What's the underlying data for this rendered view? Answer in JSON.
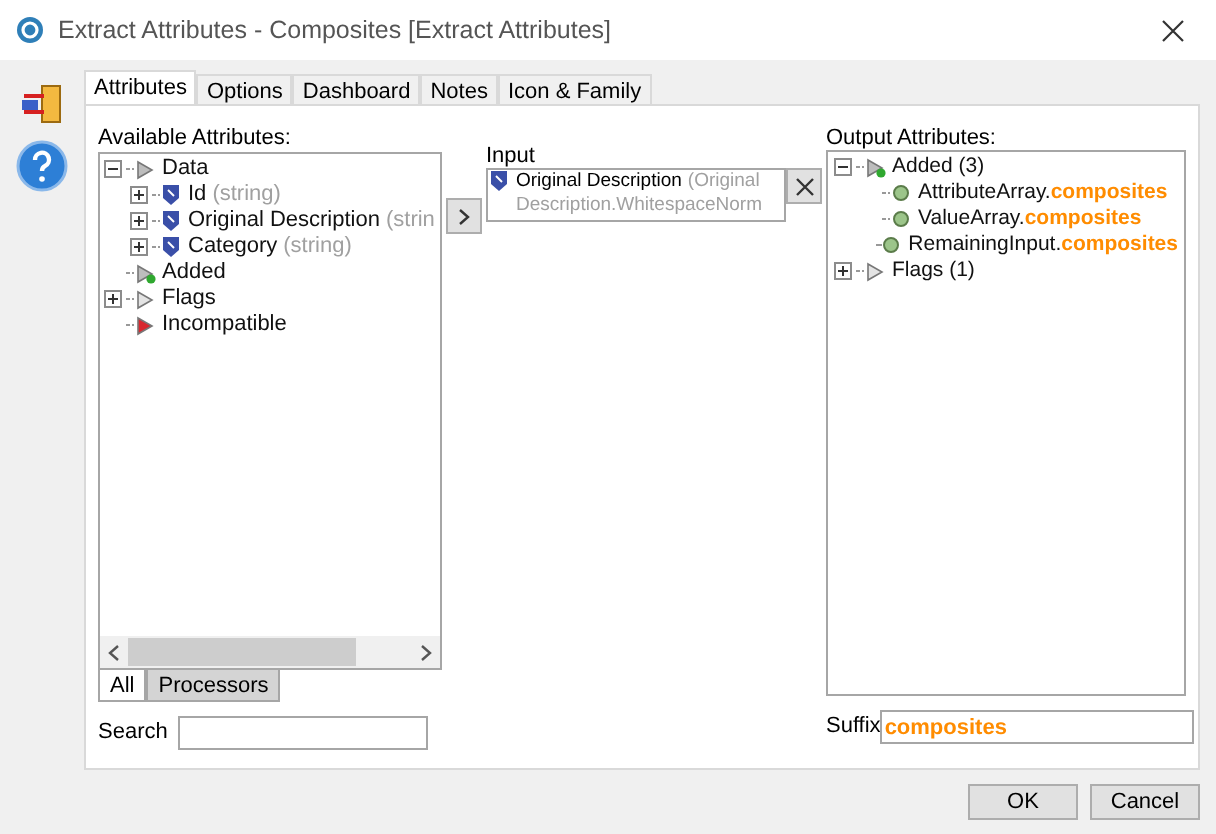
{
  "window": {
    "title": "Extract Attributes - Composites [Extract Attributes]"
  },
  "tabs": [
    {
      "label": "Attributes",
      "selected": true
    },
    {
      "label": "Options",
      "selected": false
    },
    {
      "label": "Dashboard",
      "selected": false
    },
    {
      "label": "Notes",
      "selected": false
    },
    {
      "label": "Icon & Family",
      "selected": false
    }
  ],
  "available": {
    "label": "Available Attributes:",
    "tree": [
      {
        "kind": "data",
        "label": "Data",
        "expanded": true,
        "children": [
          {
            "kind": "attribute",
            "label": "Id",
            "detail": "(string)",
            "expanded": false
          },
          {
            "kind": "attribute",
            "label": "Original Description",
            "detail": "(strin",
            "expanded": false
          },
          {
            "kind": "attribute",
            "label": "Category",
            "detail": "(string)",
            "expanded": false
          }
        ]
      },
      {
        "kind": "added",
        "label": "Added"
      },
      {
        "kind": "flags",
        "label": "Flags",
        "expanded": false
      },
      {
        "kind": "incompatible",
        "label": "Incompatible"
      }
    ]
  },
  "scope_tabs": [
    {
      "label": "All",
      "selected": true
    },
    {
      "label": "Processors",
      "selected": false
    }
  ],
  "search": {
    "label": "Search"
  },
  "input": {
    "label": "Input",
    "name": "Original Description",
    "detail": [
      "(Original",
      "Description.WhitespaceNorm"
    ]
  },
  "output": {
    "label": "Output Attributes:",
    "tree": [
      {
        "kind": "added",
        "label": "Added (3)",
        "expanded": true,
        "children": [
          {
            "kind": "output",
            "label": "AttributeArray.",
            "suffix": "composites"
          },
          {
            "kind": "output",
            "label": "ValueArray.",
            "suffix": "composites"
          },
          {
            "kind": "output",
            "label": "RemainingInput.",
            "suffix": "composites"
          }
        ]
      },
      {
        "kind": "flags",
        "label": "Flags (1)",
        "expanded": false
      }
    ]
  },
  "suffix": {
    "label": "Suffix",
    "value": "composites"
  },
  "buttons": [
    "OK",
    "Cancel"
  ]
}
